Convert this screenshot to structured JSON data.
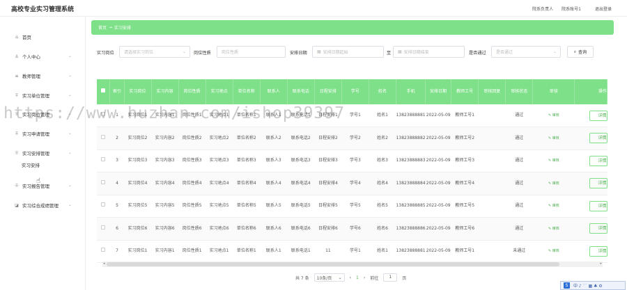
{
  "app": {
    "title": "高校专业实习管理系统",
    "user_role": "院系负责人",
    "username": "院系账号1",
    "logout": "退出登录"
  },
  "sidebar": {
    "items": [
      {
        "label": "首页",
        "icon": "home-icon",
        "glyph": "⌂",
        "has_chevron": false
      },
      {
        "label": "个人中心",
        "icon": "user-icon",
        "glyph": "♙",
        "has_chevron": true
      },
      {
        "label": "教师管理",
        "icon": "list-icon",
        "glyph": "≡",
        "has_chevron": true
      },
      {
        "label": "实习单位管理",
        "icon": "grid-icon",
        "glyph": "⠿",
        "has_chevron": true
      },
      {
        "label": "实习岗位管理",
        "icon": "grid-icon",
        "glyph": "⠿",
        "has_chevron": true
      },
      {
        "label": "实习申请管理",
        "icon": "grid-icon",
        "glyph": "⠿",
        "has_chevron": true
      },
      {
        "label": "实习安排管理",
        "icon": "grid-icon",
        "glyph": "⠿",
        "has_chevron": true
      },
      {
        "label": "实习报告管理",
        "icon": "grid-icon",
        "glyph": "⠿",
        "has_chevron": true
      },
      {
        "label": "实习综合成绩管理",
        "icon": "chart-icon",
        "glyph": "◪",
        "has_chevron": true
      }
    ],
    "sub_item": "实习安排"
  },
  "breadcrumb": {
    "home": "首页",
    "separator": "→",
    "current": "实习安排"
  },
  "filters": {
    "post_label": "实习岗位",
    "post_placeholder": "请选择实习岗位",
    "nature_label": "岗位性质",
    "nature_placeholder": "岗位性质",
    "date_label": "安排日期",
    "date_start_placeholder": "安排日期起始",
    "date_to": "至",
    "date_end_placeholder": "安排日期结束",
    "passed_label": "是否通过",
    "passed_placeholder": "是否通过",
    "query_button": "查询"
  },
  "table": {
    "headers": [
      "",
      "索引",
      "实习岗位",
      "实习内容",
      "岗位性质",
      "实习地点",
      "单位名称",
      "联系人",
      "联系电话",
      "日程安排",
      "学号",
      "姓名",
      "手机",
      "安排日期",
      "教师工号",
      "审核回复",
      "审核状态",
      "审核",
      "操作"
    ],
    "review_label": "审核",
    "detail_label": "详情",
    "rows": [
      {
        "index": "1",
        "post": "实习岗位1",
        "content": "实习内容1",
        "nature": "岗位性质1",
        "place": "实习地点1",
        "company": "单位名称1",
        "contact": "联系人1",
        "phone": "联系电话1",
        "schedule": "日程安排1",
        "student_no": "学号1",
        "name": "姓名1",
        "mobile": "13823888881",
        "date": "2022-05-09",
        "teacher_no": "教师工号1",
        "reply": "",
        "status": "通过"
      },
      {
        "index": "2",
        "post": "实习岗位2",
        "content": "实习内容2",
        "nature": "岗位性质2",
        "place": "实习地点2",
        "company": "单位名称2",
        "contact": "联系人2",
        "phone": "联系电话2",
        "schedule": "日程安排2",
        "student_no": "学号2",
        "name": "姓名2",
        "mobile": "13823888882",
        "date": "2022-05-09",
        "teacher_no": "教师工号2",
        "reply": "",
        "status": "通过"
      },
      {
        "index": "3",
        "post": "实习岗位3",
        "content": "实习内容3",
        "nature": "岗位性质3",
        "place": "实习地点3",
        "company": "单位名称3",
        "contact": "联系人3",
        "phone": "联系电话3",
        "schedule": "日程安排3",
        "student_no": "学号3",
        "name": "姓名3",
        "mobile": "13823888883",
        "date": "2022-05-09",
        "teacher_no": "教师工号3",
        "reply": "",
        "status": "通过"
      },
      {
        "index": "4",
        "post": "实习岗位4",
        "content": "实习内容4",
        "nature": "岗位性质4",
        "place": "实习地点4",
        "company": "单位名称4",
        "contact": "联系人4",
        "phone": "联系电话4",
        "schedule": "日程安排4",
        "student_no": "学号4",
        "name": "姓名4",
        "mobile": "13823888884",
        "date": "2022-05-09",
        "teacher_no": "教师工号4",
        "reply": "",
        "status": "通过"
      },
      {
        "index": "5",
        "post": "实习岗位5",
        "content": "实习内容5",
        "nature": "岗位性质5",
        "place": "实习地点5",
        "company": "单位名称5",
        "contact": "联系人5",
        "phone": "联系电话5",
        "schedule": "日程安排5",
        "student_no": "学号5",
        "name": "姓名5",
        "mobile": "13823888885",
        "date": "2022-05-09",
        "teacher_no": "教师工号5",
        "reply": "",
        "status": "通过"
      },
      {
        "index": "6",
        "post": "实习岗位6",
        "content": "实习内容6",
        "nature": "岗位性质6",
        "place": "实习地点6",
        "company": "单位名称6",
        "contact": "联系人6",
        "phone": "联系电话6",
        "schedule": "日程安排6",
        "student_no": "学号6",
        "name": "姓名6",
        "mobile": "13823888886",
        "date": "2022-05-09",
        "teacher_no": "教师工号6",
        "reply": "",
        "status": "通过"
      },
      {
        "index": "7",
        "post": "实习岗位1",
        "content": "实习内容1",
        "nature": "岗位性质1",
        "place": "实习地点1",
        "company": "单位名称1",
        "contact": "联系人1",
        "phone": "联系电话1",
        "schedule": "11",
        "student_no": "学号1",
        "name": "姓名1",
        "mobile": "13823888881",
        "date": "2022-05-09",
        "teacher_no": "教师工号1",
        "reply": "",
        "status": "未通过"
      }
    ]
  },
  "pagination": {
    "total": "共 7 条",
    "page_size": "10条/页",
    "prev": "‹",
    "current_page": "1",
    "next": "›",
    "goto_label": "前往",
    "goto_value": "1",
    "page_unit": "页"
  },
  "ime": {
    "logo": "S",
    "items": "中 ♪ ˙˙ ▦ ♣ ⚙"
  },
  "watermark": "https://www.huzhan.com/ishop39397",
  "colors": {
    "accent": "#7fe08a",
    "accent_text": "#4caf50"
  }
}
